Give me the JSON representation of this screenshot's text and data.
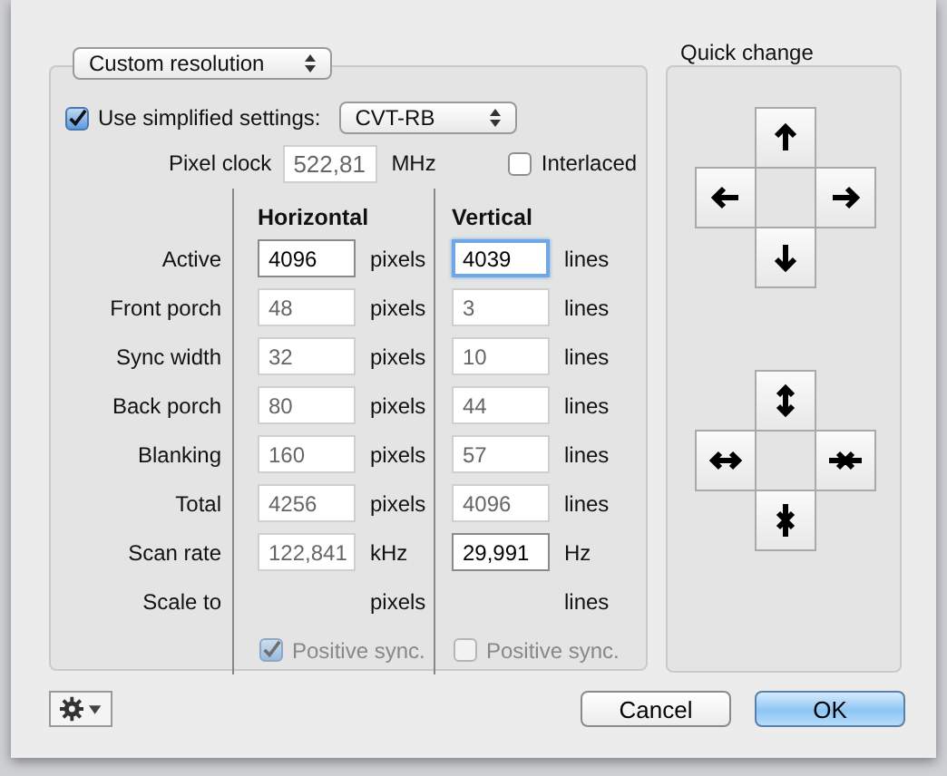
{
  "mode_dropdown": {
    "value": "Custom resolution"
  },
  "simplified": {
    "label": "Use simplified settings:",
    "checked": true,
    "dropdown": "CVT-RB"
  },
  "pixel_clock": {
    "label": "Pixel clock",
    "value": "522,81",
    "unit": "MHz",
    "interlaced": {
      "label": "Interlaced",
      "checked": false
    }
  },
  "columns": [
    "Horizontal",
    "Vertical"
  ],
  "rows": [
    {
      "label": "Active",
      "h": {
        "value": "4096",
        "kind": "editable",
        "focused": false,
        "unit": "pixels"
      },
      "v": {
        "value": "4039",
        "kind": "editable",
        "focused": true,
        "unit": "lines"
      }
    },
    {
      "label": "Front porch",
      "h": {
        "value": "48",
        "kind": "readonly",
        "focused": false,
        "unit": "pixels"
      },
      "v": {
        "value": "3",
        "kind": "readonly",
        "focused": false,
        "unit": "lines"
      }
    },
    {
      "label": "Sync width",
      "h": {
        "value": "32",
        "kind": "readonly",
        "focused": false,
        "unit": "pixels"
      },
      "v": {
        "value": "10",
        "kind": "readonly",
        "focused": false,
        "unit": "lines"
      }
    },
    {
      "label": "Back porch",
      "h": {
        "value": "80",
        "kind": "readonly",
        "focused": false,
        "unit": "pixels"
      },
      "v": {
        "value": "44",
        "kind": "readonly",
        "focused": false,
        "unit": "lines"
      }
    },
    {
      "label": "Blanking",
      "h": {
        "value": "160",
        "kind": "readonly",
        "focused": false,
        "unit": "pixels"
      },
      "v": {
        "value": "57",
        "kind": "readonly",
        "focused": false,
        "unit": "lines"
      }
    },
    {
      "label": "Total",
      "h": {
        "value": "4256",
        "kind": "readonly",
        "focused": false,
        "unit": "pixels"
      },
      "v": {
        "value": "4096",
        "kind": "readonly",
        "focused": false,
        "unit": "lines"
      }
    },
    {
      "label": "Scan rate",
      "h": {
        "value": "122,841",
        "kind": "readonly",
        "focused": false,
        "unit": "kHz"
      },
      "v": {
        "value": "29,991",
        "kind": "editable",
        "focused": false,
        "unit": "Hz"
      }
    },
    {
      "label": "Scale to",
      "h": {
        "kind": "none",
        "unit": "pixels"
      },
      "v": {
        "kind": "none",
        "unit": "lines"
      }
    }
  ],
  "sync": [
    {
      "label": "Positive sync.",
      "checked": true,
      "disabled": true
    },
    {
      "label": "Positive sync.",
      "checked": false,
      "disabled": true
    }
  ],
  "quick_change": {
    "title": "Quick change"
  },
  "buttons": [
    {
      "label": "Cancel",
      "default": false
    },
    {
      "label": "OK",
      "default": true
    }
  ]
}
